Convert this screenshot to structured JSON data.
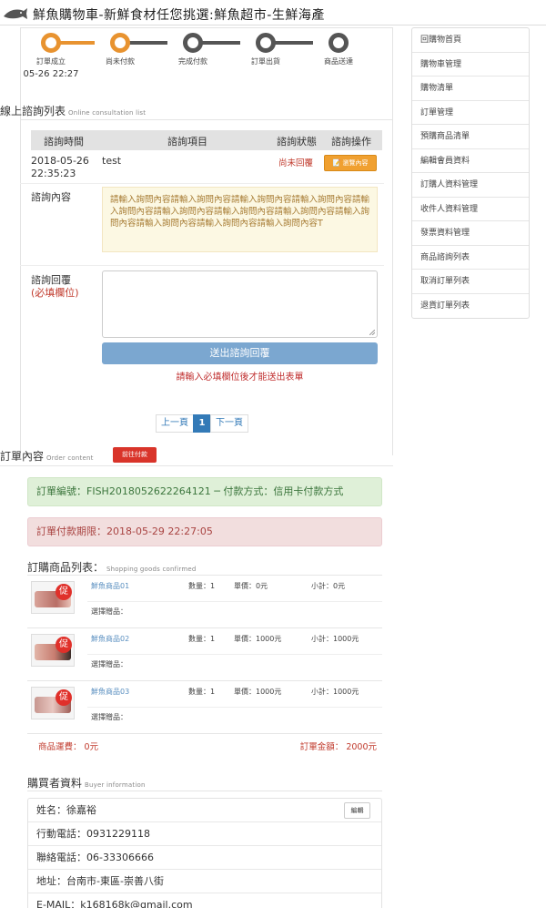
{
  "header": {
    "title": "鮮魚購物車-新鮮食材任您挑選:鮮魚超市-生鮮海產",
    "logo_icon": "fish-logo-icon"
  },
  "steps": [
    {
      "label": "訂單成立",
      "date": "05-26 22:27",
      "active": true
    },
    {
      "label": "尚未付款",
      "active": true
    },
    {
      "label": "完成付款",
      "active": false
    },
    {
      "label": "訂單出貨",
      "active": false
    },
    {
      "label": "商品送達",
      "active": false
    }
  ],
  "consult": {
    "title": "線上諮詢列表",
    "title_en": "Online consultation list",
    "headers": {
      "time": "諮詢時間",
      "item": "諮詢項目",
      "status": "諮詢狀態",
      "action": "諮詢操作"
    },
    "row": {
      "time": "2018-05-26 22:35:23",
      "item": "test",
      "status": "尚未回覆",
      "view_label": "📝 瀏覽內容"
    },
    "content_label": "諮詢內容",
    "content_text": "請輸入詢問內容請輸入詢問內容請輸入詢問內容請輸入詢問內容請輸入詢問內容請輸入詢問內容請輸入詢問內容請輸入詢問內容請輸入詢問內容請輸入詢問內容請輸入詢問內容請輸入詢問內容T",
    "reply_label": "諮詢回覆",
    "reply_required": "(必填欄位)",
    "submit_label": "送出諮詢回覆",
    "warning": "請輸入必填欄位後才能送出表單"
  },
  "pagination": {
    "prev": "上一頁",
    "current": "1",
    "next": "下一頁"
  },
  "order": {
    "title": "訂單內容",
    "title_en": "Order content",
    "pay_button": "前往付款",
    "number_line": "訂單編號：FISH2018052622264121 ─ 付款方式：信用卡付款方式",
    "deadline_line": "訂單付款期限：2018-05-29 22:27:05"
  },
  "products": {
    "title": "訂購商品列表：",
    "title_en": "Shopping goods confirmed",
    "promo_badge": "促",
    "gift_label": "選擇贈品：",
    "items": [
      {
        "name": "鮮魚商品01",
        "qty": "數量：1",
        "price": "單價：0元",
        "subtotal": "小計：0元"
      },
      {
        "name": "鮮魚商品02",
        "qty": "數量：1",
        "price": "單價：1000元",
        "subtotal": "小計：1000元"
      },
      {
        "name": "鮮魚商品03",
        "qty": "數量：1",
        "price": "單價：1000元",
        "subtotal": "小計：1000元"
      }
    ],
    "shipping": "商品運費： 0元",
    "total": "訂單金額： 2000元"
  },
  "buyer": {
    "title": "購買者資料",
    "title_en": "Buyer information",
    "edit_label": "編輯",
    "rows": [
      "姓名：徐嘉裕",
      "行動電話：0931229118",
      "聯絡電話：06-33306666",
      "地址：台南市-東區-崇善八街",
      "E-MAIL：k168168k@gmail.com"
    ]
  },
  "sidebar": {
    "items": [
      "回購物首頁",
      "購物車管理",
      "購物清單",
      "訂單管理",
      "預購商品清單",
      "編輯會員資料",
      "訂購人資料管理",
      "收件人資料管理",
      "發票資料管理",
      "商品諮詢列表",
      "取消訂單列表",
      "退貨訂單列表"
    ]
  },
  "colors": {
    "accent": "#e89330",
    "step_inactive": "#555555",
    "danger": "#d9342a",
    "link": "#337ab7"
  }
}
